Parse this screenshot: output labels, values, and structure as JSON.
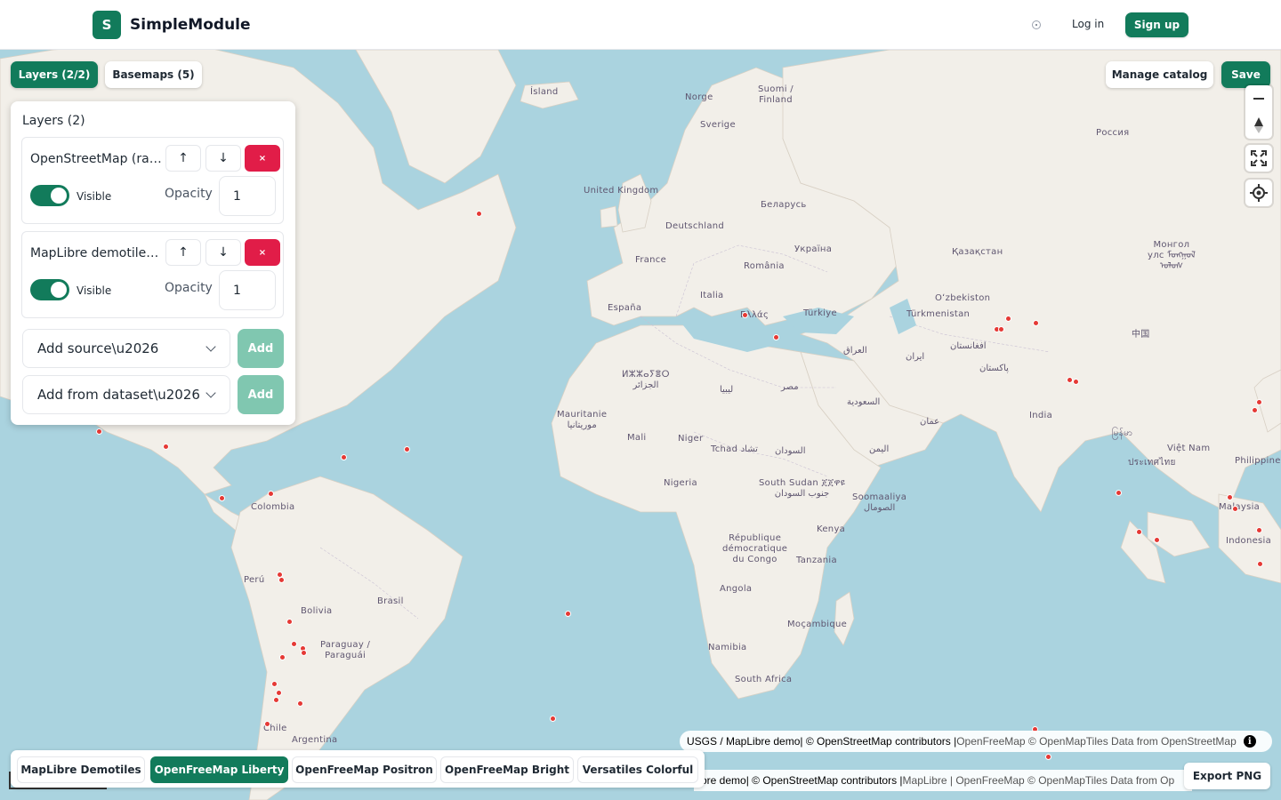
{
  "header": {
    "logo_letter": "S",
    "brand": "SimpleModule",
    "login": "Log in",
    "signup": "Sign up"
  },
  "toolbar": {
    "layers_tab": "Layers (2/2)",
    "basemaps_tab": "Basemaps (5)",
    "manage_catalog": "Manage catalog",
    "save": "Save"
  },
  "panel": {
    "title": "Layers (2)",
    "layers": [
      {
        "name": "OpenStreetMap (raster)",
        "visible_label": "Visible",
        "opacity_label": "Opacity",
        "opacity": "1"
      },
      {
        "name": "MapLibre demotiles polygons",
        "visible_label": "Visible",
        "opacity_label": "Opacity",
        "opacity": "1"
      }
    ],
    "add_source_placeholder": "Add source\\u2026",
    "add_dataset_placeholder": "Add from dataset\\u2026",
    "add_label": "Add",
    "remove_glyph": "×",
    "up_glyph": "↑",
    "down_glyph": "↓"
  },
  "map_labels": [
    {
      "text": "Ísland"
    },
    {
      "text": "Norge"
    },
    {
      "text": "Suomi /\nFinland"
    },
    {
      "text": "Sverige"
    },
    {
      "text": "Россия"
    },
    {
      "text": "United Kingdom"
    },
    {
      "text": "Беларусь"
    },
    {
      "text": "Deutschland"
    },
    {
      "text": "Україна"
    },
    {
      "text": "Қазақстан"
    },
    {
      "text": "Монгол\nулс ᠮᠣᠩᠭᠣᠯ\nᠤᠯᠤᠰ"
    },
    {
      "text": "France"
    },
    {
      "text": "România"
    },
    {
      "text": "Oʻzbekiston"
    },
    {
      "text": "Italia"
    },
    {
      "text": "España"
    },
    {
      "text": "Ελλάς"
    },
    {
      "text": "Türkiye"
    },
    {
      "text": "Türkmenistan"
    },
    {
      "text": "中国"
    },
    {
      "text": "افغانستان"
    },
    {
      "text": "العراق"
    },
    {
      "text": "ایران"
    },
    {
      "text": "پاکستان"
    },
    {
      "text": "ⵍⵣⵣⴰⵢⴻⵔ\nالجزائر"
    },
    {
      "text": "ليبيا"
    },
    {
      "text": "مصر"
    },
    {
      "text": "السعودية"
    },
    {
      "text": "India"
    },
    {
      "text": "عمان"
    },
    {
      "text": "မြန်မာ"
    },
    {
      "text": "Mauritanie\nموريتانيا"
    },
    {
      "text": "Mali"
    },
    {
      "text": "Niger"
    },
    {
      "text": "Tchad تشاد"
    },
    {
      "text": "السودان"
    },
    {
      "text": "اليمن"
    },
    {
      "text": "Việt Nam"
    },
    {
      "text": "ประเทศไทย"
    },
    {
      "text": "Philippines"
    },
    {
      "text": "Nigeria"
    },
    {
      "text": "South Sudan ጀጀዋዩ\nجنوب السودان"
    },
    {
      "text": "Soomaaliya\nالصومال"
    },
    {
      "text": "Malaysia"
    },
    {
      "text": "Colombia"
    },
    {
      "text": "Kenya"
    },
    {
      "text": "République\ndémocratique\ndu Congo"
    },
    {
      "text": "Indonesia"
    },
    {
      "text": "Tanzania"
    },
    {
      "text": "Perú"
    },
    {
      "text": "Angola"
    },
    {
      "text": "Brasil"
    },
    {
      "text": "Bolivia"
    },
    {
      "text": "Moçambique"
    },
    {
      "text": "Paraguay /\nParaguái"
    },
    {
      "text": "Namibia"
    },
    {
      "text": "South Africa"
    },
    {
      "text": "Chile"
    },
    {
      "text": "Argentina"
    }
  ],
  "attribution_top": {
    "a": "USGS / MapLibre demo",
    "b": " | © OpenStreetMap contributors | ",
    "c": "OpenFreeMap © OpenMapTiles Data from OpenStreetMap"
  },
  "attribution_bottom": {
    "a": "ore demo",
    "b": " | © OpenStreetMap contributors | ",
    "c": "MapLibre | OpenFreeMap © OpenMapTiles Data from Op"
  },
  "basemaps": [
    {
      "label": "MapLibre Demotiles"
    },
    {
      "label": "OpenFreeMap Liberty",
      "active": true
    },
    {
      "label": "OpenFreeMap Positron"
    },
    {
      "label": "OpenFreeMap Bright"
    },
    {
      "label": "Versatiles Colorful"
    }
  ],
  "export_png": "Export PNG",
  "colors": {
    "brand": "#127b5b",
    "danger": "#e11d48",
    "ocean": "#aad3df",
    "land": "#f2efe9",
    "marker": "#e53935"
  }
}
